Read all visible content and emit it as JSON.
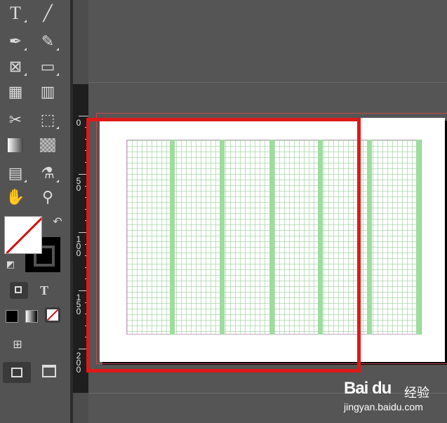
{
  "ruler": {
    "labels": [
      "0",
      "5\n0",
      "1\n0\n0",
      "1\n5\n0",
      "2\n0\n0"
    ]
  },
  "tools": [
    {
      "name": "type-tool",
      "glyph": "T"
    },
    {
      "name": "line-tool",
      "glyph": "╱"
    },
    {
      "name": "pen-tool",
      "glyph": "✒"
    },
    {
      "name": "pencil-tool",
      "glyph": "✎"
    },
    {
      "name": "rectangle-frame-tool",
      "glyph": "⊠"
    },
    {
      "name": "rectangle-tool",
      "glyph": "▭"
    },
    {
      "name": "grid-table-tool",
      "glyph": "▦"
    },
    {
      "name": "column-grid-tool",
      "glyph": "▥"
    },
    {
      "name": "scissors-tool",
      "glyph": "✂"
    },
    {
      "name": "free-transform-tool",
      "glyph": "⬚"
    },
    {
      "name": "gradient-swatch-tool",
      "glyph": "▩"
    },
    {
      "name": "gradient-feather-tool",
      "glyph": "▧"
    },
    {
      "name": "note-tool",
      "glyph": "▤"
    },
    {
      "name": "eyedropper-tool",
      "glyph": "⚗"
    },
    {
      "name": "hand-tool",
      "glyph": "✋"
    },
    {
      "name": "zoom-tool",
      "glyph": "⚲"
    }
  ],
  "format_text_glyph": "T",
  "watermark": {
    "brand": "Bai du",
    "cn": "经验",
    "url": "jingyan.baidu.com"
  }
}
